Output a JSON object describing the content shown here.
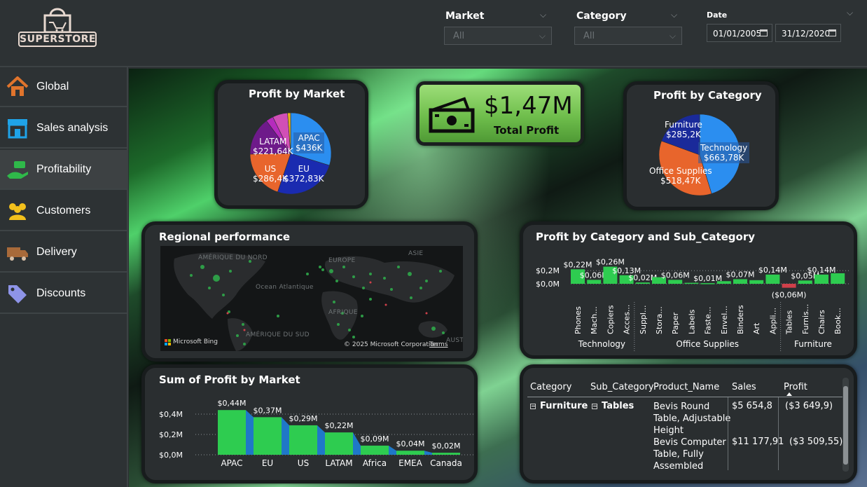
{
  "header": {
    "logo_text": "SUPERSTORE",
    "slicers": [
      {
        "label": "Market",
        "value": "All"
      },
      {
        "label": "Category",
        "value": "All"
      }
    ],
    "date": {
      "label": "Date",
      "start": "01/01/2005",
      "end": "31/12/2020"
    }
  },
  "sidebar": {
    "items": [
      {
        "label": "Global",
        "icon": "home-icon",
        "color": "#e0742c"
      },
      {
        "label": "Sales analysis",
        "icon": "store-icon",
        "color": "#1fa3e8"
      },
      {
        "label": "Profitability",
        "icon": "money-hand-icon",
        "color": "#2fb84a"
      },
      {
        "label": "Customers",
        "icon": "users-icon",
        "color": "#f2c01c"
      },
      {
        "label": "Delivery",
        "icon": "truck-icon",
        "color": "#a86a3a"
      },
      {
        "label": "Discounts",
        "icon": "tag-icon",
        "color": "#8e94e8"
      }
    ],
    "active_index": 2
  },
  "kpi": {
    "value": "$1,47M",
    "label": "Total Profit",
    "icon": "cash-icon"
  },
  "profit_by_market": {
    "title": "Profit by Market",
    "chart_data": {
      "type": "pie",
      "labels": [
        "APAC",
        "EU",
        "US",
        "LATAM",
        "EMEA",
        "Africa",
        "Canada"
      ],
      "values": [
        436,
        372.83,
        286.4,
        221.64,
        43,
        88,
        17.8
      ],
      "value_labels": [
        "$436K",
        "$372,83K",
        "$286,4K",
        "$221,64K"
      ],
      "colors": [
        "#2b8ef0",
        "#1a2bb0",
        "#e8652c",
        "#6e1a8a",
        "#b52bbd",
        "#d14fb6",
        "#e8b21c"
      ]
    }
  },
  "profit_by_category": {
    "title": "Profit by Category",
    "chart_data": {
      "type": "pie",
      "labels": [
        "Technology",
        "Office Supplies",
        "Furniture"
      ],
      "values": [
        663.78,
        518.47,
        285.2
      ],
      "value_labels": [
        "$663,78K",
        "$518,47K",
        "$285,2K"
      ],
      "colors": [
        "#2b8ef0",
        "#e8652c",
        "#1a2a9a"
      ]
    }
  },
  "regional": {
    "title": "Regional performance",
    "map_labels": [
      "AMÉRIQUE DU NORD",
      "EUROPE",
      "ASIE",
      "Ocean Atlantique",
      "AFRIQUE",
      "AMÉRIQUE DU SUD",
      "AUSTR"
    ],
    "credit": "© 2025 Microsoft Corporation",
    "terms": "Terms",
    "bing": "Microsoft Bing"
  },
  "profit_subcat": {
    "title": "Profit by Category and Sub_Category",
    "chart_data": {
      "type": "bar",
      "y_ticks": [
        "$0,2M",
        "$0,0M"
      ],
      "ylim": [
        -0.06,
        0.3
      ],
      "categories": [
        "Phones",
        "Mach...",
        "Copiers",
        "Acces...",
        "Suppl...",
        "Stora...",
        "Paper",
        "Labels",
        "Faste...",
        "Envel...",
        "Binders",
        "Art",
        "Appli...",
        "Tables",
        "Furnis...",
        "Chairs",
        "Book..."
      ],
      "groups": [
        {
          "name": "Technology",
          "count": 4
        },
        {
          "name": "Office Supplies",
          "count": 9
        },
        {
          "name": "Furniture",
          "count": 4
        }
      ],
      "values": [
        0.22,
        0.06,
        0.26,
        0.13,
        0.02,
        0.1,
        0.06,
        0.015,
        0.01,
        0.04,
        0.07,
        0.055,
        0.14,
        -0.06,
        0.05,
        0.14,
        0.16
      ],
      "data_labels": [
        "$0,22M",
        "$0,06M",
        "$0,26M",
        "$0,13M",
        "$0,02M",
        "",
        "$0,06M",
        "",
        "$0,01M",
        "",
        "$0,07M",
        "",
        "$0,14M",
        "($0,06M)",
        "$0,05M",
        "$0,14M",
        ""
      ],
      "colors": {
        "positive": "#2ecc50",
        "negative": "#d0404a"
      }
    }
  },
  "sum_profit_market": {
    "title": "Sum of Profit by Market",
    "chart_data": {
      "type": "bar",
      "categories": [
        "APAC",
        "EU",
        "US",
        "LATAM",
        "Africa",
        "EMEA",
        "Canada"
      ],
      "values": [
        0.44,
        0.37,
        0.29,
        0.22,
        0.09,
        0.04,
        0.02
      ],
      "data_labels": [
        "$0,44M",
        "$0,37M",
        "$0,29M",
        "$0,22M",
        "$0,09M",
        "$0,04M",
        "$0,02M"
      ],
      "y_ticks": [
        "$0,4M",
        "$0,2M",
        "$0,0M"
      ],
      "ylim": [
        0,
        0.5
      ],
      "colors": {
        "bar": "#2ecc50",
        "ribbon": "#1f78c8"
      }
    }
  },
  "table": {
    "headers": [
      "Category",
      "Sub_Category",
      "Product_Name",
      "Sales",
      "Profit"
    ],
    "category": "Furniture",
    "sub_category": "Tables",
    "rows": [
      {
        "product_lines": [
          "Bevis Round",
          "Table, Adjustable",
          "Height"
        ],
        "sales": "$5 654,8",
        "profit": "($3 649,9)"
      },
      {
        "product_lines": [
          "Bevis Computer",
          "Table, Fully",
          "Assembled"
        ],
        "sales": "$11 177,91",
        "profit": "($3 509,55)"
      }
    ]
  }
}
